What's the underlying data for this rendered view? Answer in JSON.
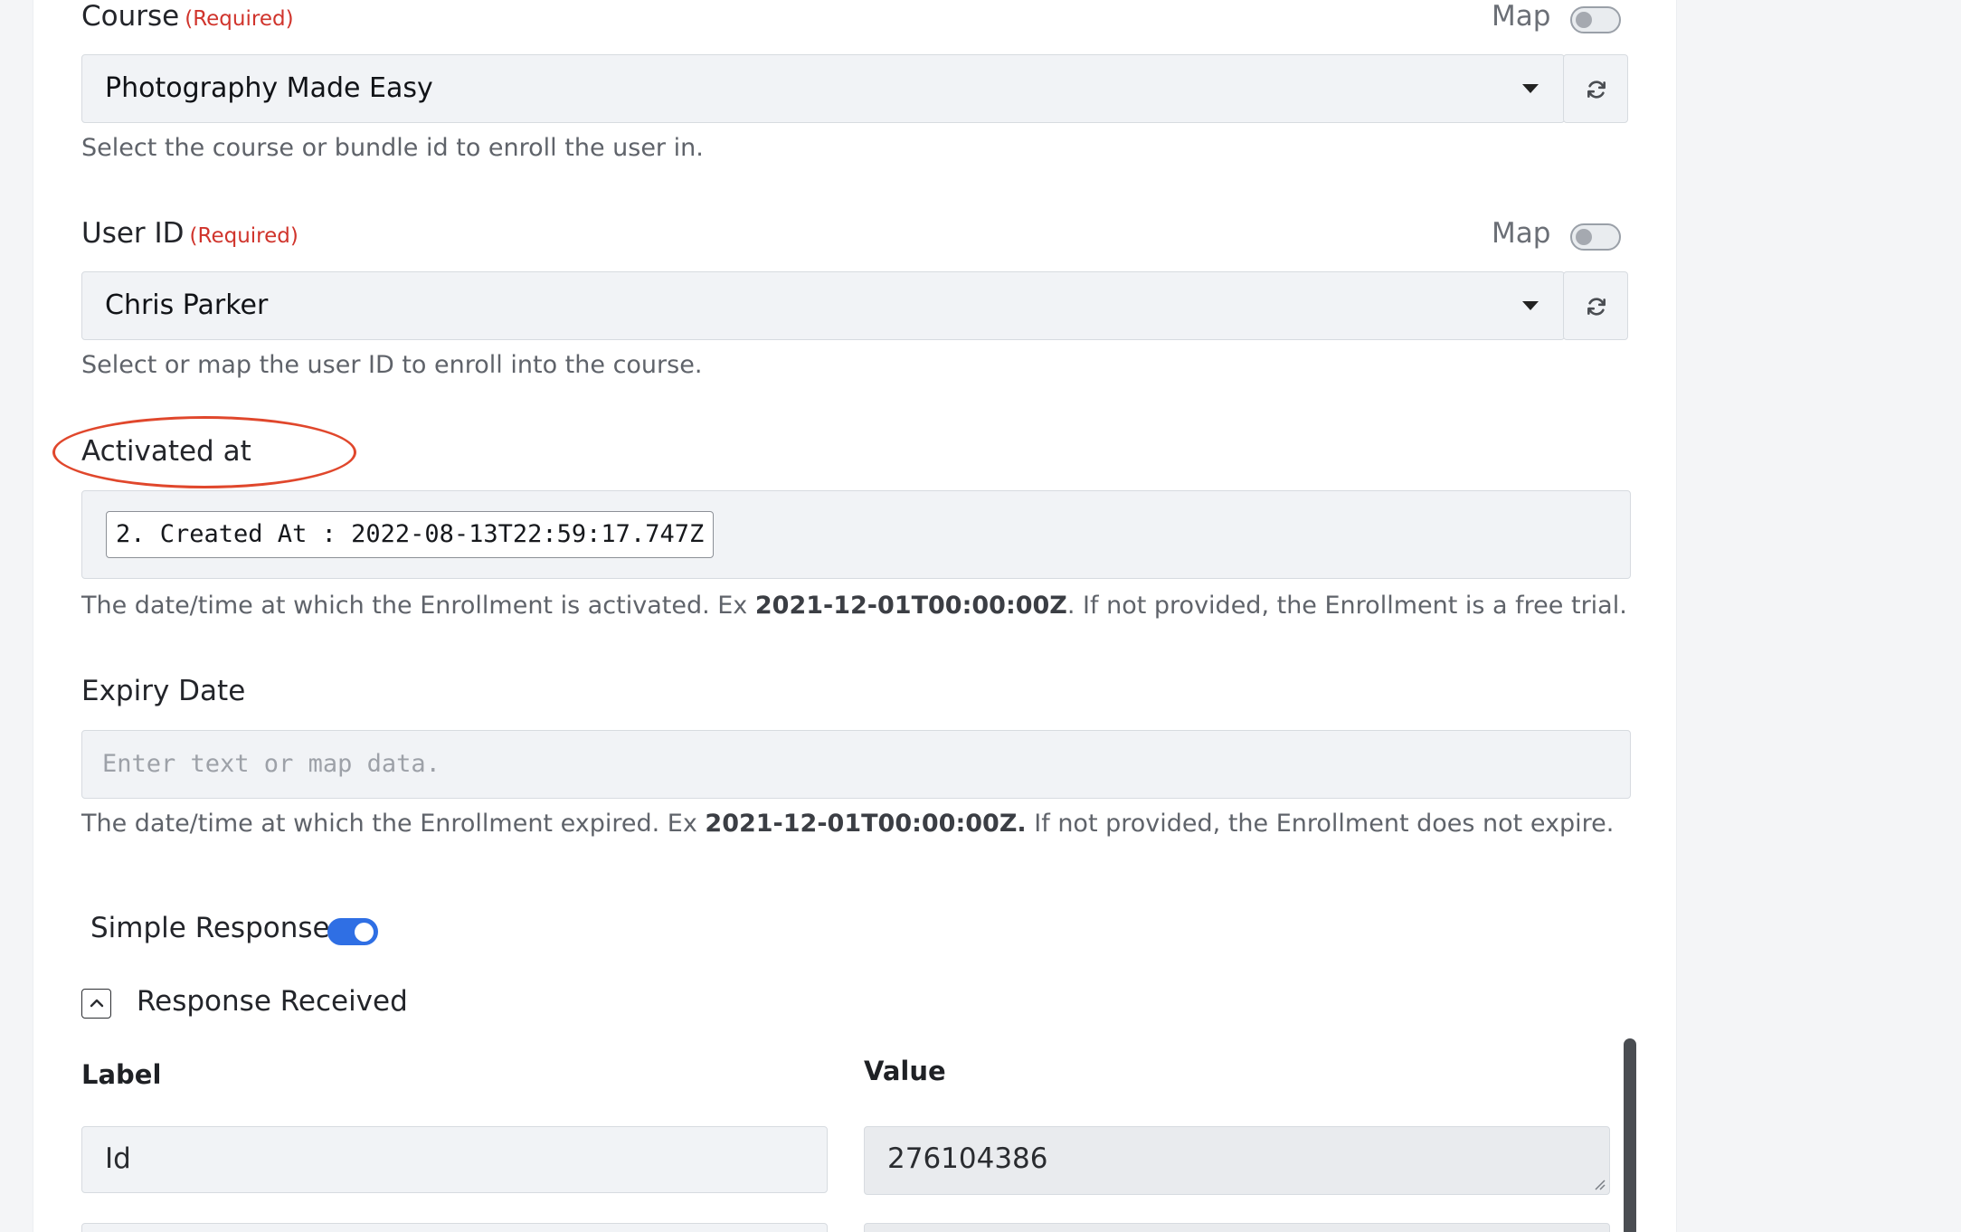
{
  "course": {
    "label": "Course",
    "required": "(Required)",
    "map_label": "Map",
    "map_enabled": false,
    "selected": "Photography Made Easy",
    "help": "Select the course or bundle id to enroll the user in."
  },
  "user_id": {
    "label": "User ID",
    "required": "(Required)",
    "map_label": "Map",
    "map_enabled": false,
    "selected": "Chris Parker",
    "help": "Select or map the user ID to enroll into the course."
  },
  "activated_at": {
    "label": "Activated at",
    "chip": "2. Created At : 2022-08-13T22:59:17.747Z",
    "help_before": "The date/time at which the Enrollment is activated. Ex ",
    "help_bold": "2021-12-01T00:00:00Z",
    "help_after": ". If not provided, the Enrollment is a free trial.",
    "highlight_color": "#e0472c"
  },
  "expiry_date": {
    "label": "Expiry Date",
    "placeholder": "Enter text or map data.",
    "help_before": "The date/time at which the Enrollment expired. Ex ",
    "help_bold": "2021-12-01T00:00:00Z.",
    "help_after": " If not provided, the Enrollment does not expire."
  },
  "simple_response": {
    "label": "Simple Response",
    "enabled": true
  },
  "response_received": {
    "label": "Response Received",
    "expanded": true,
    "columns": {
      "label": "Label",
      "value": "Value"
    },
    "rows": [
      {
        "label": "Id",
        "value": "276104386"
      }
    ]
  },
  "icons": {
    "refresh": "refresh-icon",
    "caret": "caret-down-icon",
    "collapse": "chevron-up-icon"
  },
  "colors": {
    "accent": "#2f6fe4",
    "required": "#d0342c"
  }
}
